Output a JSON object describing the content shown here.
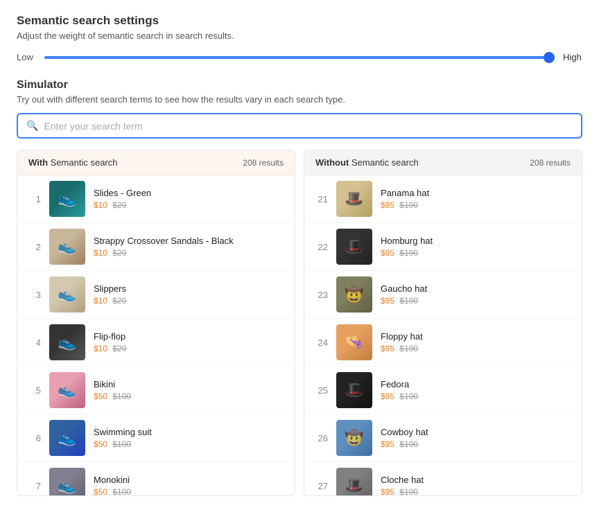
{
  "settings": {
    "title": "Semantic search settings",
    "description": "Adjust the weight of semantic search in search results.",
    "slider": {
      "min": 0,
      "max": 100,
      "value": 100,
      "label_low": "Low",
      "label_high": "High"
    }
  },
  "simulator": {
    "title": "Simulator",
    "description": "Try out with different search terms to see how the results vary in each search type.",
    "search_placeholder": "Enter your search term"
  },
  "with_panel": {
    "header_bold": "With",
    "header_text": " Semantic search",
    "results_count": "208 results",
    "items": [
      {
        "rank": 1,
        "name": "Slides - Green",
        "price_current": "$10",
        "price_original": "$20",
        "img_class": "img-slides"
      },
      {
        "rank": 2,
        "name": "Strappy Crossover Sandals - Black",
        "price_current": "$10",
        "price_original": "$20",
        "img_class": "img-sandals"
      },
      {
        "rank": 3,
        "name": "Slippers",
        "price_current": "$10",
        "price_original": "$20",
        "img_class": "img-slippers"
      },
      {
        "rank": 4,
        "name": "Flip-flop",
        "price_current": "$10",
        "price_original": "$20",
        "img_class": "img-flipflop"
      },
      {
        "rank": 5,
        "name": "Bikini",
        "price_current": "$50",
        "price_original": "$100",
        "img_class": "img-bikini"
      },
      {
        "rank": 6,
        "name": "Swimming suit",
        "price_current": "$50",
        "price_original": "$100",
        "img_class": "img-swim"
      },
      {
        "rank": 7,
        "name": "Monokini",
        "price_current": "$50",
        "price_original": "$100",
        "img_class": "img-mono"
      }
    ]
  },
  "without_panel": {
    "header_bold": "Without",
    "header_text": " Semantic search",
    "results_count": "208 results",
    "items": [
      {
        "rank": 21,
        "name": "Panama hat",
        "price_current": "$95",
        "price_original": "$100",
        "img_class": "img-panama"
      },
      {
        "rank": 22,
        "name": "Homburg hat",
        "price_current": "$95",
        "price_original": "$100",
        "img_class": "img-homburg"
      },
      {
        "rank": 23,
        "name": "Gaucho hat",
        "price_current": "$95",
        "price_original": "$100",
        "img_class": "img-gaucho"
      },
      {
        "rank": 24,
        "name": "Floppy hat",
        "price_current": "$95",
        "price_original": "$100",
        "img_class": "img-floppy"
      },
      {
        "rank": 25,
        "name": "Fedora",
        "price_current": "$95",
        "price_original": "$100",
        "img_class": "img-fedora"
      },
      {
        "rank": 26,
        "name": "Cowboy hat",
        "price_current": "$95",
        "price_original": "$100",
        "img_class": "img-cowboy"
      },
      {
        "rank": 27,
        "name": "Cloche hat",
        "price_current": "$95",
        "price_original": "$100",
        "img_class": "img-cloche"
      }
    ]
  }
}
